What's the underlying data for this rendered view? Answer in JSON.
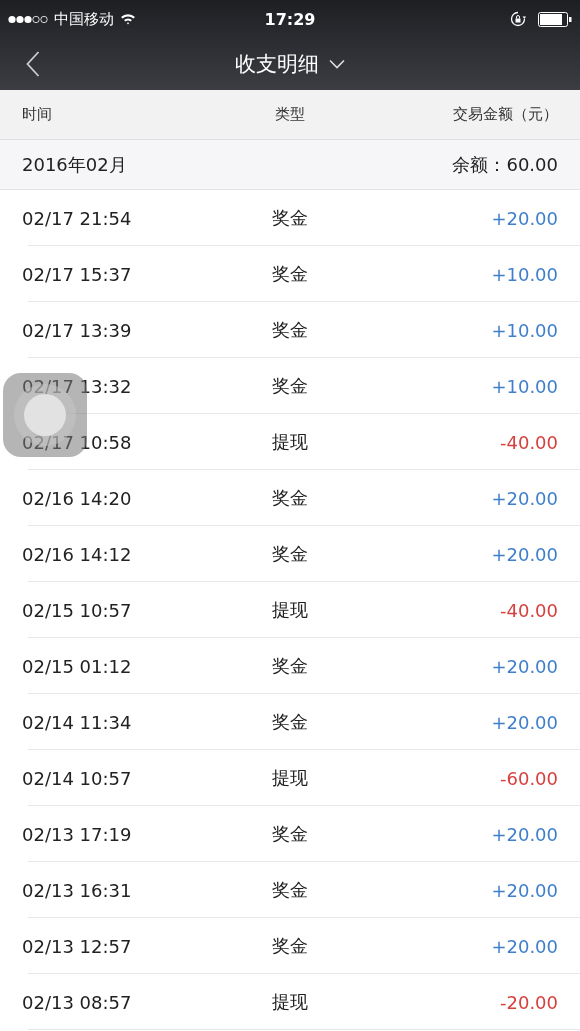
{
  "status_bar": {
    "carrier": "中国移动",
    "time": "17:29"
  },
  "nav": {
    "title": "收支明细"
  },
  "columns": [
    "时间",
    "类型",
    "交易金额（元）"
  ],
  "month": {
    "label": "2016年02月",
    "balance": "余额：60.00"
  },
  "rows": [
    {
      "time": "02/17 21:54",
      "type": "奖金",
      "amount": "+20.00",
      "color": "#3f7fcb"
    },
    {
      "time": "02/17 15:37",
      "type": "奖金",
      "amount": "+10.00",
      "color": "#3f7fcb"
    },
    {
      "time": "02/17 13:39",
      "type": "奖金",
      "amount": "+10.00",
      "color": "#3f7fcb"
    },
    {
      "time": "02/17 13:32",
      "type": "奖金",
      "amount": "+10.00",
      "color": "#3f7fcb"
    },
    {
      "time": "02/17 10:58",
      "type": "提现",
      "amount": "-40.00",
      "color": "#d6403d"
    },
    {
      "time": "02/16 14:20",
      "type": "奖金",
      "amount": "+20.00",
      "color": "#3f7fcb"
    },
    {
      "time": "02/16 14:12",
      "type": "奖金",
      "amount": "+20.00",
      "color": "#3f7fcb"
    },
    {
      "time": "02/15 10:57",
      "type": "提现",
      "amount": "-40.00",
      "color": "#d6403d"
    },
    {
      "time": "02/15 01:12",
      "type": "奖金",
      "amount": "+20.00",
      "color": "#3f7fcb"
    },
    {
      "time": "02/14 11:34",
      "type": "奖金",
      "amount": "+20.00",
      "color": "#3f7fcb"
    },
    {
      "time": "02/14 10:57",
      "type": "提现",
      "amount": "-60.00",
      "color": "#d6403d"
    },
    {
      "time": "02/13 17:19",
      "type": "奖金",
      "amount": "+20.00",
      "color": "#3f7fcb"
    },
    {
      "time": "02/13 16:31",
      "type": "奖金",
      "amount": "+20.00",
      "color": "#3f7fcb"
    },
    {
      "time": "02/13 12:57",
      "type": "奖金",
      "amount": "+20.00",
      "color": "#3f7fcb"
    },
    {
      "time": "02/13 08:57",
      "type": "提现",
      "amount": "-20.00",
      "color": "#d6403d"
    }
  ]
}
